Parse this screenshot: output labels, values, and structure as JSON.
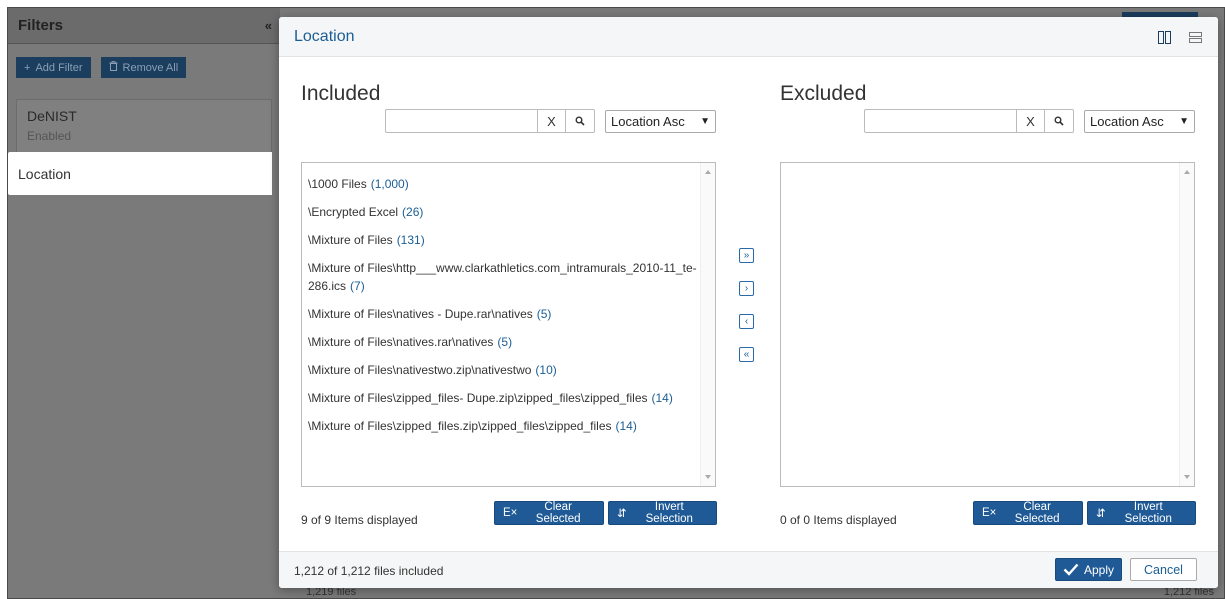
{
  "sidebar": {
    "title": "Filters",
    "collapse_glyph": "«",
    "add_filter_label": "Add Filter",
    "remove_all_label": "Remove All",
    "card": {
      "title": "DeNIST",
      "subtitle": "Enabled"
    },
    "active_item": "Location"
  },
  "background": {
    "footer_left": "1,219 files",
    "footer_right": "1,212 files"
  },
  "modal": {
    "title": "Location",
    "included": {
      "title": "Included",
      "search_value": "",
      "clear_label": "X",
      "sort_label": "Location Asc",
      "items": [
        {
          "path": "\\1000 Files",
          "count": "(1,000)"
        },
        {
          "path": "\\Encrypted Excel",
          "count": "(26)"
        },
        {
          "path": "\\Mixture of Files",
          "count": "(131)"
        },
        {
          "path": "\\Mixture of Files\\http___www.clarkathletics.com_intramurals_2010-11_te-286.ics",
          "count": "(7)"
        },
        {
          "path": "\\Mixture of Files\\natives - Dupe.rar\\natives",
          "count": "(5)"
        },
        {
          "path": "\\Mixture of Files\\natives.rar\\natives",
          "count": "(5)"
        },
        {
          "path": "\\Mixture of Files\\nativestwo.zip\\nativestwo",
          "count": "(10)"
        },
        {
          "path": "\\Mixture of Files\\zipped_files- Dupe.zip\\zipped_files\\zipped_files",
          "count": "(14)"
        },
        {
          "path": "\\Mixture of Files\\zipped_files.zip\\zipped_files\\zipped_files",
          "count": "(14)"
        }
      ],
      "status": "9 of 9 Items displayed",
      "clear_selected_label": "Clear Selected",
      "invert_selection_label": "Invert Selection"
    },
    "excluded": {
      "title": "Excluded",
      "search_value": "",
      "clear_label": "X",
      "sort_label": "Location Asc",
      "status": "0 of 0 Items displayed",
      "clear_selected_label": "Clear Selected",
      "invert_selection_label": "Invert Selection"
    },
    "transfer": {
      "move_all_right": "»",
      "move_right": "›",
      "move_left": "‹",
      "move_all_left": "«"
    },
    "footer": {
      "status": "1,212 of 1,212 files included",
      "apply_label": "Apply",
      "cancel_label": "Cancel"
    }
  },
  "colors": {
    "accent": "#1f5a96",
    "link": "#1b5e94",
    "overlay": "#7a7a7a"
  }
}
